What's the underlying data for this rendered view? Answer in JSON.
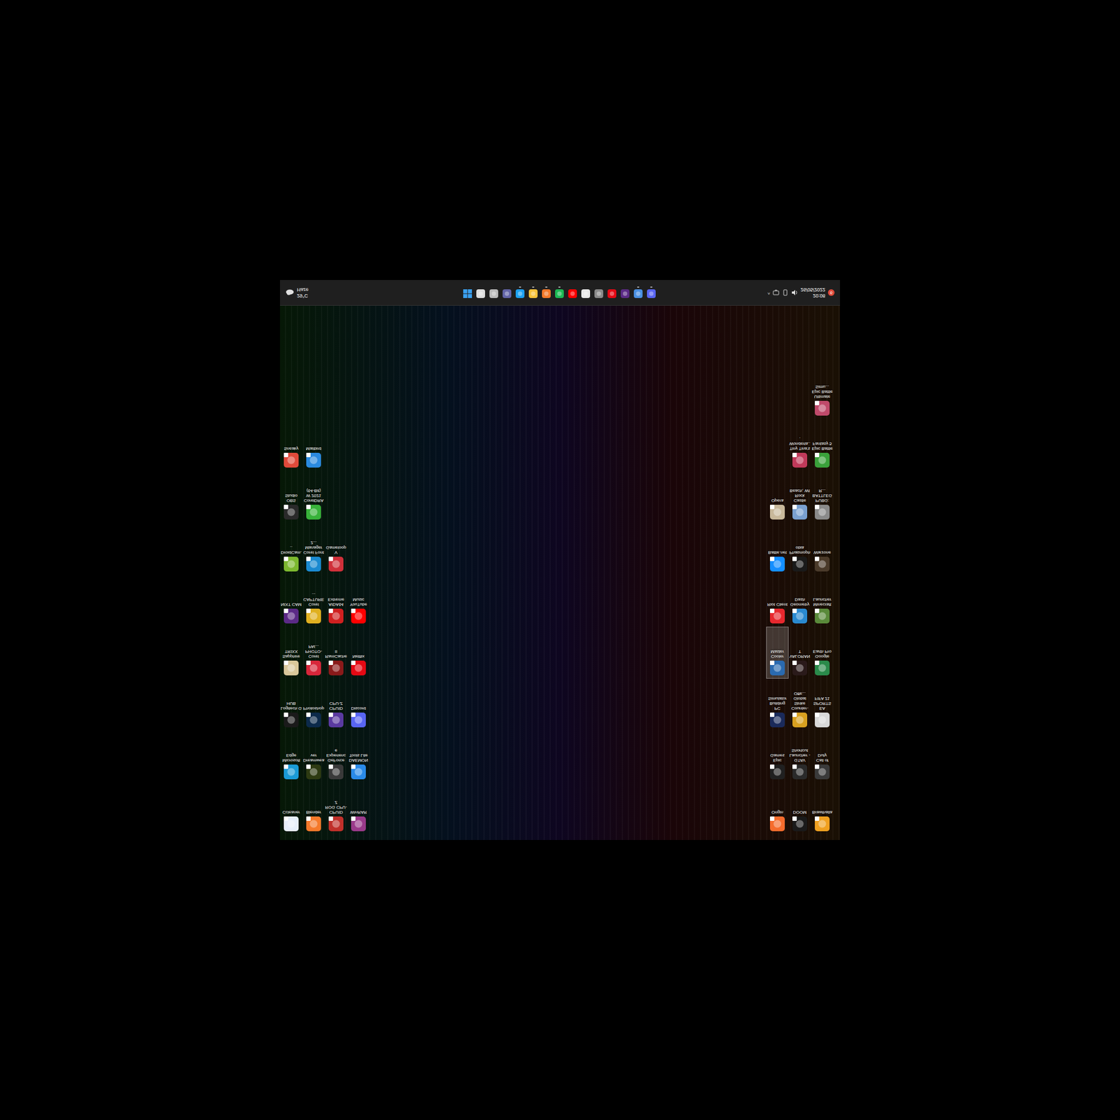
{
  "desktop": {
    "left_columns": [
      [
        {
          "label": "Ccleaner",
          "color": "#e8f0fb",
          "selected": false
        },
        {
          "label": "Microsoft Edge",
          "color": "#1a9bd7",
          "selected": false
        },
        {
          "label": "Logitech G HUB",
          "color": "#1a1a1a",
          "selected": false
        },
        {
          "label": "Sapphire TRIXX",
          "color": "#d9c89a",
          "selected": false
        },
        {
          "label": "NIXT CAM",
          "color": "#5b2a86",
          "selected": false
        },
        {
          "label": "DroidCam...",
          "color": "#7cb82f",
          "selected": false
        },
        {
          "label": "OBS Studio",
          "color": "#2a2a2a",
          "selected": false
        },
        {
          "label": "Sneaky",
          "color": "#e04a3a",
          "selected": false
        }
      ],
      [
        {
          "label": "Blender",
          "color": "#f5792a",
          "selected": false
        },
        {
          "label": "Dreamweaver",
          "color": "#2d3a12",
          "selected": false
        },
        {
          "label": "Photoshop",
          "color": "#0c2a4a",
          "selected": false
        },
        {
          "label": "Corel PHOTO-PAI...",
          "color": "#d8263a",
          "selected": false
        },
        {
          "label": "Corel CAPTURE ...",
          "color": "#e0b020",
          "selected": false
        },
        {
          "label": "Corel Font Manager 2...",
          "color": "#1a8ad0",
          "selected": false
        },
        {
          "label": "CorelDRAW 2021 (64-Bit)",
          "color": "#38b23a",
          "selected": false
        },
        {
          "label": "Mailbird",
          "color": "#2a8ae0",
          "selected": false
        }
      ],
      [
        {
          "label": "CPUID ROG CPU-Z",
          "color": "#c0302a",
          "selected": false
        },
        {
          "label": "GeForce Experience",
          "color": "#3a3a3a",
          "selected": false
        },
        {
          "label": "CPUID CPU-Z",
          "color": "#5a3aa0",
          "selected": false
        },
        {
          "label": "RamCache II",
          "color": "#8a1a1a",
          "selected": false
        },
        {
          "label": "AIDA64 Extreme",
          "color": "#d02020",
          "selected": false
        },
        {
          "label": "V Gameloop",
          "color": "#d0303a",
          "selected": false
        }
      ],
      [
        {
          "label": "WinRAR",
          "color": "#9a3a8a",
          "selected": false
        },
        {
          "label": "DAEMON Tools Lite",
          "color": "#2a8ae8",
          "selected": false
        },
        {
          "label": "Discord",
          "color": "#5865f2",
          "selected": false
        },
        {
          "label": "Netflix",
          "color": "#e50914",
          "selected": false
        },
        {
          "label": "YouTube Music",
          "color": "#ff0000",
          "selected": false
        }
      ]
    ],
    "right_columns": [
      [
        {
          "label": "Origin",
          "color": "#f56c2d",
          "selected": false
        },
        {
          "label": "Epic Games",
          "color": "#202020",
          "selected": false
        },
        {
          "label": "PC Building Simulator",
          "color": "#1a2a5a",
          "selected": false
        },
        {
          "label": "Cooler Master",
          "color": "#2a6ab0",
          "selected": true
        },
        {
          "label": "Riot Client",
          "color": "#e8282e",
          "selected": false
        },
        {
          "label": "Battle.net",
          "color": "#148eff",
          "selected": false
        },
        {
          "label": "Opera",
          "color": "#c8b89a",
          "selected": false
        }
      ],
      [
        {
          "label": "DOOM",
          "color": "#1a1a1a",
          "selected": false
        },
        {
          "label": "GTAV Launcher - Shortcut",
          "color": "#2a2a2a",
          "selected": false
        },
        {
          "label": "Counter-Strike Global Offe...",
          "color": "#d8a020",
          "selected": false
        },
        {
          "label": "VALORANT",
          "color": "#2a1a1a",
          "selected": false
        },
        {
          "label": "Geometry Dash",
          "color": "#2a8ad0",
          "selected": false
        },
        {
          "label": "Phasmophobia",
          "color": "#1a1a1a",
          "selected": false
        },
        {
          "label": "Castle Rock Beach, WI",
          "color": "#7aa0d0",
          "selected": false
        },
        {
          "label": "Tiny Tina's Wonderla...",
          "color": "#c03a5a",
          "selected": false
        }
      ],
      [
        {
          "label": "Brawlhalla",
          "color": "#f0a020",
          "selected": false
        },
        {
          "label": "Call of Duty",
          "color": "#3a3a3a",
          "selected": false
        },
        {
          "label": "EA SPORTS FIFA 21",
          "color": "#d8d8d8",
          "selected": false
        },
        {
          "label": "Google Earth Pro",
          "color": "#2a8a4a",
          "selected": false
        },
        {
          "label": "Minecraft Launcher",
          "color": "#5a8a3a",
          "selected": false
        },
        {
          "label": "Warzone",
          "color": "#4a3a2a",
          "selected": false
        },
        {
          "label": "PUBG: BATTLEGR...",
          "color": "#8a8a8a",
          "selected": false
        },
        {
          "label": "Epic Battle Fantasy 5",
          "color": "#3aa03a",
          "selected": false
        },
        {
          "label": "Ultimate Epic Battle Simu...",
          "color": "#c04a6a",
          "selected": false
        }
      ]
    ]
  },
  "taskbar": {
    "weather": {
      "temp": "29°C",
      "condition": "Haze"
    },
    "apps": [
      {
        "kind": "start",
        "color": "#3aa0f0",
        "running": false
      },
      {
        "kind": "app",
        "color": "#dddddd",
        "running": false
      },
      {
        "kind": "app",
        "color": "#bbbbbb",
        "running": false
      },
      {
        "kind": "app",
        "color": "#6264a7",
        "running": false
      },
      {
        "kind": "app",
        "color": "#1da1f2",
        "running": true
      },
      {
        "kind": "app",
        "color": "#f8c33b",
        "running": true
      },
      {
        "kind": "app",
        "color": "#f5792a",
        "running": true
      },
      {
        "kind": "app",
        "color": "#1db954",
        "running": true
      },
      {
        "kind": "app",
        "color": "#ff0000",
        "running": false
      },
      {
        "kind": "app",
        "color": "#e8e8e8",
        "running": false
      },
      {
        "kind": "app",
        "color": "#8a8a8a",
        "running": false
      },
      {
        "kind": "app",
        "color": "#e50914",
        "running": false
      },
      {
        "kind": "app",
        "color": "#5b2a86",
        "running": false
      },
      {
        "kind": "app",
        "color": "#4a90e2",
        "running": true
      },
      {
        "kind": "app",
        "color": "#5865f2",
        "running": true
      }
    ],
    "tray": {
      "chevron": "^",
      "time": "20:08",
      "date": "26/05/2022",
      "badge": "6"
    }
  }
}
